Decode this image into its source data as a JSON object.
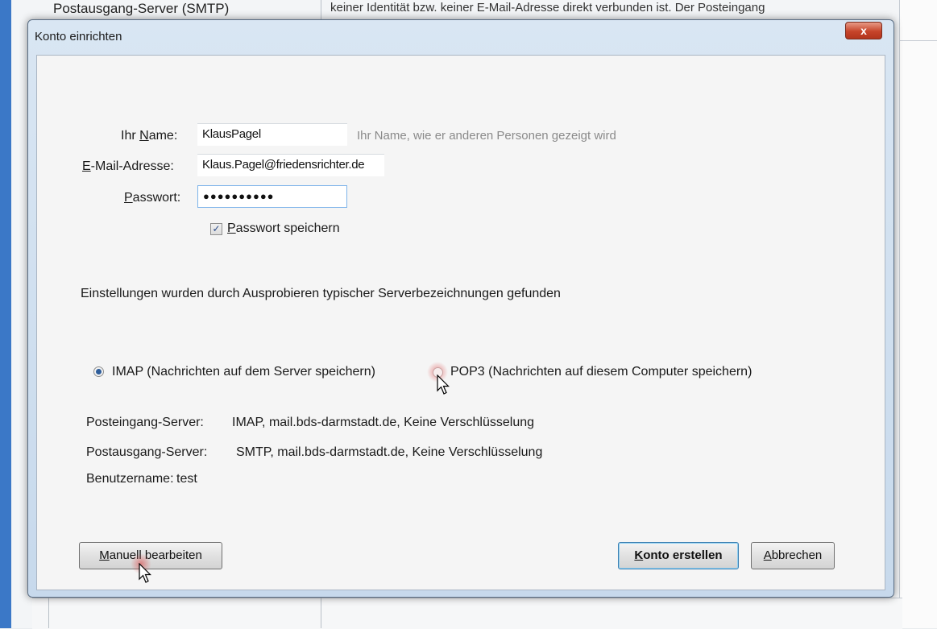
{
  "background": {
    "top_label": "Postausgang-Server (SMTP)",
    "top_text": "keiner Identität bzw. keiner E-Mail-Adresse direkt verbunden ist. Der Posteingang"
  },
  "dialog": {
    "title": "Konto einrichten",
    "close_symbol": "x",
    "name": {
      "label_pre": "Ihr ",
      "label_u": "N",
      "label_post": "ame:",
      "value": "KlausPagel",
      "hint": "Ihr Name, wie er anderen Personen gezeigt wird"
    },
    "email": {
      "label_u": "E",
      "label_post": "-Mail-Adresse:",
      "value": "Klaus.Pagel@friedensrichter.de"
    },
    "password": {
      "label_u": "P",
      "label_post": "asswort:",
      "value": "●●●●●●●●●●"
    },
    "save_password": {
      "label_u": "P",
      "label_post": "asswort speichern",
      "checked": true
    },
    "found_message": "Einstellungen wurden durch Ausprobieren typischer Serverbezeichnungen gefunden",
    "protocol": {
      "imap_label": "IMAP (Nachrichten auf dem Server speichern)",
      "pop3_label": "POP3 (Nachrichten auf diesem Computer speichern)",
      "selected": "IMAP"
    },
    "servers": {
      "incoming_label": "Posteingang-Server:",
      "incoming_value": "IMAP, mail.bds-darmstadt.de, Keine Verschlüsselung",
      "outgoing_label": "Postausgang-Server:",
      "outgoing_value": "SMTP, mail.bds-darmstadt.de, Keine Verschlüsselung",
      "username_label": "Benutzername:",
      "username_value": "test"
    },
    "buttons": {
      "manual_u": "M",
      "manual_post": "anuell bearbeiten",
      "create_u": "K",
      "create_post": "onto erstellen",
      "cancel_u": "A",
      "cancel_post": "bbrechen"
    }
  },
  "colors": {
    "title_bar": "#d9e6f3",
    "close_button": "#c6442a",
    "client_bg": "#f5f5f5",
    "radio_selected": "#2e5d9a",
    "cursor_click": "#dc3c3c"
  },
  "icons": [
    "close-icon",
    "checkmark-icon",
    "mouse-cursor-icon"
  ]
}
